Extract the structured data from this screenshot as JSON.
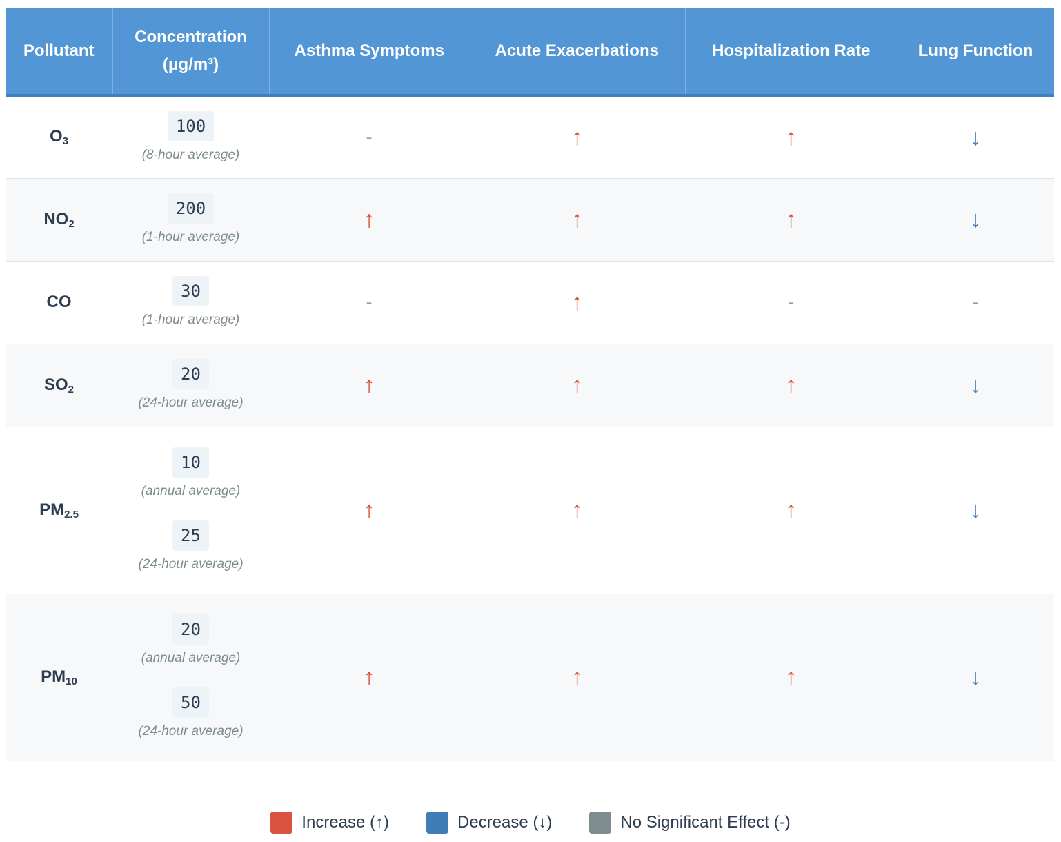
{
  "colors": {
    "header_bg": "#5296d5",
    "increase": "#dc5240",
    "decrease": "#3f7db8",
    "no_effect": "#7f8c8d"
  },
  "headers": {
    "pollutant": "Pollutant",
    "concentration": "Concentration (μg/m³)",
    "asthma": "Asthma Symptoms",
    "exacerbations": "Acute Exacerbations",
    "hospitalization": "Hospitalization Rate",
    "lung": "Lung Function"
  },
  "rows": [
    {
      "pollutant": "O",
      "sub": "3",
      "concentrations": [
        {
          "value": "100",
          "note": "(8-hour average)"
        }
      ],
      "effects": [
        "-",
        "↑",
        "↑",
        "↓"
      ]
    },
    {
      "pollutant": "NO",
      "sub": "2",
      "concentrations": [
        {
          "value": "200",
          "note": "(1-hour average)"
        }
      ],
      "effects": [
        "↑",
        "↑",
        "↑",
        "↓"
      ]
    },
    {
      "pollutant": "CO",
      "sub": "",
      "concentrations": [
        {
          "value": "30",
          "note": "(1-hour average)"
        }
      ],
      "effects": [
        "-",
        "↑",
        "-",
        "-"
      ]
    },
    {
      "pollutant": "SO",
      "sub": "2",
      "concentrations": [
        {
          "value": "20",
          "note": "(24-hour average)"
        }
      ],
      "effects": [
        "↑",
        "↑",
        "↑",
        "↓"
      ]
    },
    {
      "pollutant": "PM",
      "sub": "2.5",
      "concentrations": [
        {
          "value": "10",
          "note": "(annual average)"
        },
        {
          "value": "25",
          "note": "(24-hour average)"
        }
      ],
      "effects": [
        "↑",
        "↑",
        "↑",
        "↓"
      ]
    },
    {
      "pollutant": "PM",
      "sub": "10",
      "concentrations": [
        {
          "value": "20",
          "note": "(annual average)"
        },
        {
          "value": "50",
          "note": "(24-hour average)"
        }
      ],
      "effects": [
        "↑",
        "↑",
        "↑",
        "↓"
      ]
    }
  ],
  "legend": {
    "increase": "Increase (↑)",
    "decrease": "Decrease (↓)",
    "no_effect": "No Significant Effect (-)"
  }
}
